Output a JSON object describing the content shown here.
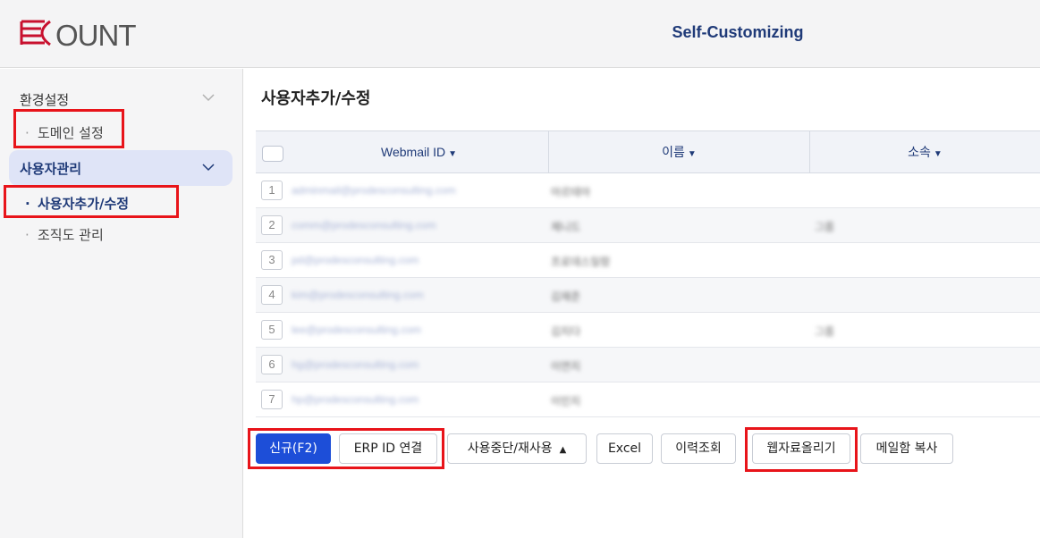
{
  "header": {
    "logo_text": "ECOUNT",
    "title": "Self-Customizing"
  },
  "sidebar": {
    "groups": [
      {
        "label": "환경설정",
        "items": [
          "도메인 설정"
        ]
      },
      {
        "label": "사용자관리",
        "items": [
          "사용자추가/수정",
          "조직도 관리"
        ]
      }
    ]
  },
  "main": {
    "title": "사용자추가/수정",
    "columns": [
      "Webmail ID",
      "이름",
      "소속"
    ],
    "rows": [
      {
        "num": "1",
        "email": "adminmail@prodesconsulting.com",
        "name": "아르테아",
        "dept": ""
      },
      {
        "num": "2",
        "email": "comm@prodesconsulting.com",
        "name": "제니드",
        "dept": "그룹"
      },
      {
        "num": "3",
        "email": "pd@prodesconsulting.com",
        "name": "프로데스일람",
        "dept": ""
      },
      {
        "num": "4",
        "email": "kim@prodesconsulting.com",
        "name": "김재준",
        "dept": ""
      },
      {
        "num": "5",
        "email": "lee@prodesconsulting.com",
        "name": "김지다",
        "dept": "그룹"
      },
      {
        "num": "6",
        "email": "hg@prodesconsulting.com",
        "name": "이연지",
        "dept": ""
      },
      {
        "num": "7",
        "email": "hp@prodesconsulting.com",
        "name": "이민지",
        "dept": ""
      }
    ]
  },
  "toolbar": {
    "new_label": "신규(F2)",
    "erp_label": "ERP ID 연결",
    "suspend_label": "사용중단/재사용",
    "excel_label": "Excel",
    "history_label": "이력조회",
    "upload_label": "웹자료올리기",
    "copy_mail_label": "메일함 복사"
  },
  "colors": {
    "accent": "#1d4ed8",
    "header_text": "#1f3a78",
    "highlight": "#e8141a",
    "active_bg": "#dfe4f7"
  }
}
